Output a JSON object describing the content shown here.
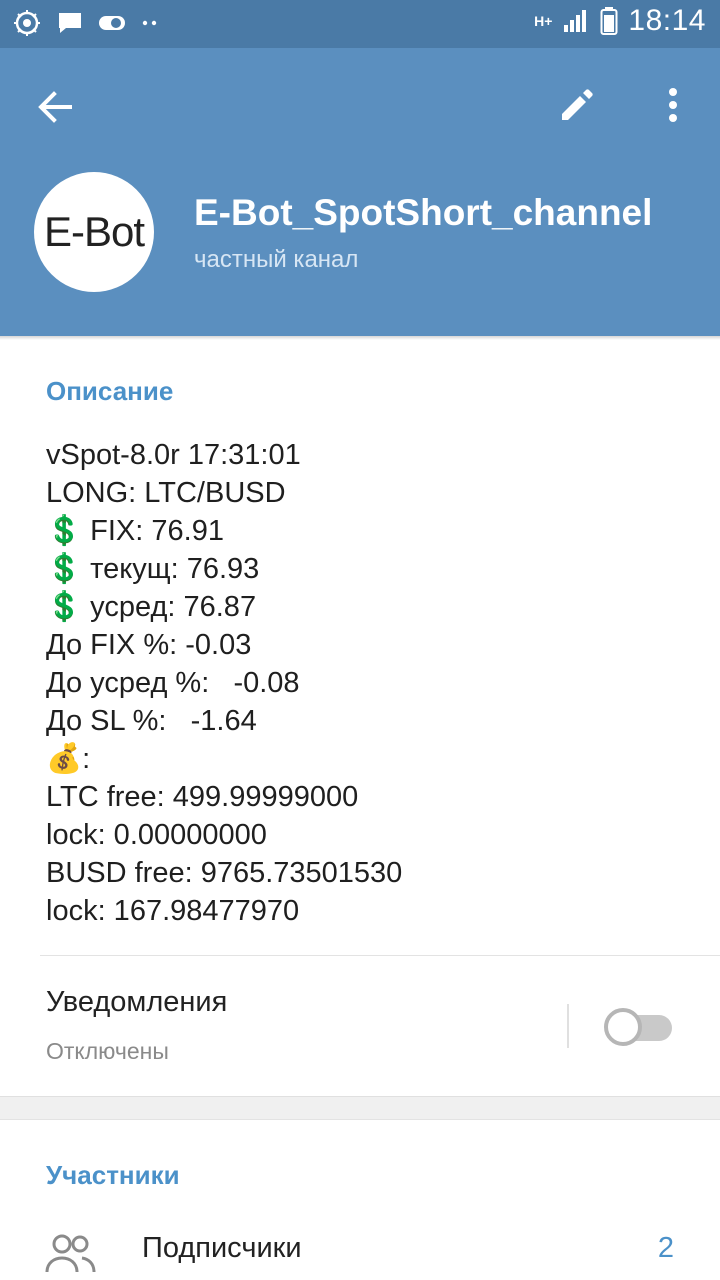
{
  "status_bar": {
    "time": "18:14",
    "network": "H+",
    "icons": [
      "app-notification-icon",
      "message-icon",
      "toggle-icon",
      "more-notifications-icon",
      "signal-icon",
      "battery-icon"
    ]
  },
  "header": {
    "avatar_text": "E-Bot",
    "title": "E-Bot_SpotShort_channel",
    "subtitle": "частный канал",
    "background_color": "#5b8fbf",
    "icons": [
      "back-arrow-icon",
      "edit-pencil-icon",
      "more-vert-icon"
    ]
  },
  "description": {
    "title": "Описание",
    "lines": [
      "vSpot-8.0r 17:31:01",
      "LONG: LTC/BUSD",
      "💲 FIX: 76.91",
      "💲 текущ: 76.93",
      "💲 усред: 76.87",
      "До FIX %: -0.03",
      "До усред %:   -0.08",
      "До SL %:   -1.64",
      "💰:",
      "LTC free: 499.99999000",
      "lock: 0.00000000",
      "BUSD free: 9765.73501530",
      "lock: 167.98477970"
    ]
  },
  "notifications": {
    "title": "Уведомления",
    "status": "Отключены",
    "enabled": false
  },
  "members": {
    "title": "Участники",
    "subscribers_label": "Подписчики",
    "subscribers_count": "2"
  },
  "colors": {
    "accent": "#4b91c9",
    "status_bar": "#4a7aa6"
  }
}
